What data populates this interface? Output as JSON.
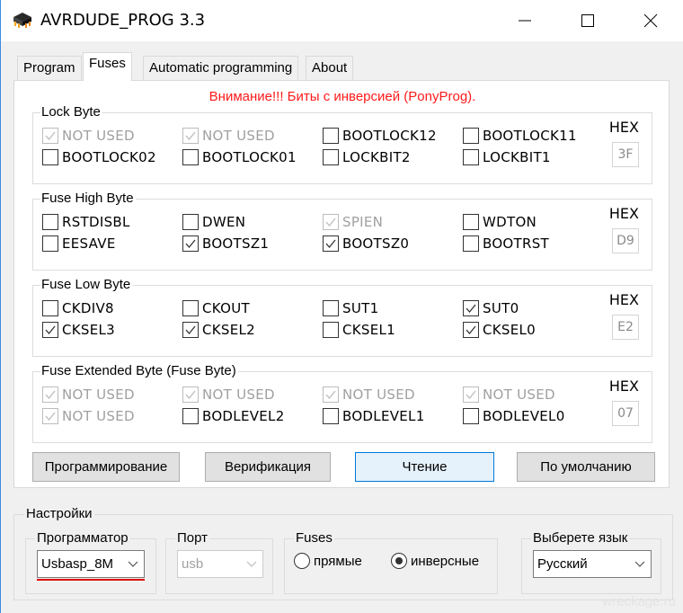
{
  "window": {
    "title": "AVRDUDE_PROG 3.3",
    "icon": "chip-icon",
    "controls": {
      "minimize": "minimize-icon",
      "maximize": "maximize-icon",
      "close": "close-icon"
    }
  },
  "tabs": [
    {
      "label": "Program",
      "active": false
    },
    {
      "label": "Fuses",
      "active": true
    },
    {
      "label": "Automatic programming",
      "active": false
    },
    {
      "label": "About",
      "active": false
    }
  ],
  "warning": "Внимание!!! Биты с инверсией (PonyProg).",
  "hex_label": "HEX",
  "groups": [
    {
      "title": "Lock Byte",
      "hex": "3F",
      "bits": [
        {
          "label": "NOT USED",
          "checked": true,
          "disabled": true
        },
        {
          "label": "NOT USED",
          "checked": true,
          "disabled": true
        },
        {
          "label": "BOOTLOCK12",
          "checked": false,
          "disabled": false
        },
        {
          "label": "BOOTLOCK11",
          "checked": false,
          "disabled": false
        },
        {
          "label": "BOOTLOCK02",
          "checked": false,
          "disabled": false
        },
        {
          "label": "BOOTLOCK01",
          "checked": false,
          "disabled": false
        },
        {
          "label": "LOCKBIT2",
          "checked": false,
          "disabled": false
        },
        {
          "label": "LOCKBIT1",
          "checked": false,
          "disabled": false
        }
      ]
    },
    {
      "title": "Fuse High Byte",
      "hex": "D9",
      "bits": [
        {
          "label": "RSTDISBL",
          "checked": false,
          "disabled": false
        },
        {
          "label": "DWEN",
          "checked": false,
          "disabled": false
        },
        {
          "label": "SPIEN",
          "checked": true,
          "disabled": true
        },
        {
          "label": "WDTON",
          "checked": false,
          "disabled": false
        },
        {
          "label": "EESAVE",
          "checked": false,
          "disabled": false
        },
        {
          "label": "BOOTSZ1",
          "checked": true,
          "disabled": false
        },
        {
          "label": "BOOTSZ0",
          "checked": true,
          "disabled": false
        },
        {
          "label": "BOOTRST",
          "checked": false,
          "disabled": false
        }
      ]
    },
    {
      "title": "Fuse Low Byte",
      "hex": "E2",
      "bits": [
        {
          "label": "CKDIV8",
          "checked": false,
          "disabled": false
        },
        {
          "label": "CKOUT",
          "checked": false,
          "disabled": false
        },
        {
          "label": "SUT1",
          "checked": false,
          "disabled": false
        },
        {
          "label": "SUT0",
          "checked": true,
          "disabled": false
        },
        {
          "label": "CKSEL3",
          "checked": true,
          "disabled": false
        },
        {
          "label": "CKSEL2",
          "checked": true,
          "disabled": false
        },
        {
          "label": "CKSEL1",
          "checked": false,
          "disabled": false
        },
        {
          "label": "CKSEL0",
          "checked": true,
          "disabled": false
        }
      ]
    },
    {
      "title": "Fuse Extended Byte (Fuse Byte)",
      "hex": "07",
      "bits": [
        {
          "label": "NOT USED",
          "checked": true,
          "disabled": true
        },
        {
          "label": "NOT USED",
          "checked": true,
          "disabled": true
        },
        {
          "label": "NOT USED",
          "checked": true,
          "disabled": true
        },
        {
          "label": "NOT USED",
          "checked": true,
          "disabled": true
        },
        {
          "label": "NOT USED",
          "checked": true,
          "disabled": true
        },
        {
          "label": "BODLEVEL2",
          "checked": false,
          "disabled": false
        },
        {
          "label": "BODLEVEL1",
          "checked": false,
          "disabled": false
        },
        {
          "label": "BODLEVEL0",
          "checked": false,
          "disabled": false
        }
      ]
    }
  ],
  "buttons": {
    "program": "Программирование",
    "verify": "Верификация",
    "read": "Чтение",
    "default": "По умолчанию"
  },
  "settings": {
    "title": "Настройки",
    "programmer": {
      "label": "Программатор",
      "value": "Usbasp_8M"
    },
    "port": {
      "label": "Порт",
      "value": "usb"
    },
    "fuses": {
      "label": "Fuses",
      "options": [
        {
          "label": "прямые",
          "selected": false
        },
        {
          "label": "инверсные",
          "selected": true
        }
      ]
    },
    "language": {
      "label": "Выберете язык",
      "value": "Русский"
    }
  },
  "watermark": "wreckage.ru",
  "colors": {
    "warning": "#ff1a1a",
    "focus_border": "#0078d7",
    "underline": "#e00000"
  }
}
